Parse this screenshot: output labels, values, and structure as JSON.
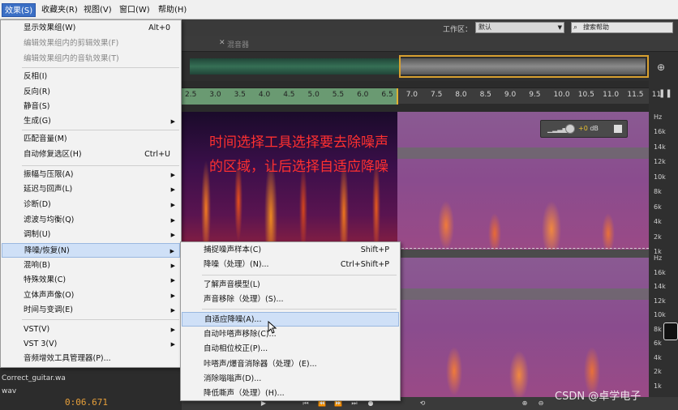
{
  "menubar": {
    "items": [
      "效果(S)",
      "收藏夹(R)",
      "视图(V)",
      "窗口(W)",
      "帮助(H)"
    ]
  },
  "header": {
    "workspace_label": "工作区：",
    "workspace_value": "默认",
    "search_placeholder": "搜索帮助",
    "mixer_tab": "混音器"
  },
  "effects_menu": {
    "items": [
      {
        "label": "显示效果组(W)",
        "shortcut": "Alt+0",
        "disabled": false,
        "submenu": false
      },
      {
        "label": "编辑效果组内的剪辑效果(F)",
        "shortcut": "",
        "disabled": true,
        "submenu": false
      },
      {
        "label": "编辑效果组内的音轨效果(T)",
        "shortcut": "",
        "disabled": true,
        "submenu": false
      },
      {
        "label": "反相(I)",
        "shortcut": "",
        "disabled": false,
        "submenu": false
      },
      {
        "label": "反向(R)",
        "shortcut": "",
        "disabled": false,
        "submenu": false
      },
      {
        "label": "静音(S)",
        "shortcut": "",
        "disabled": false,
        "submenu": false
      },
      {
        "label": "生成(G)",
        "shortcut": "",
        "disabled": false,
        "submenu": true
      },
      {
        "label": "匹配音量(M)",
        "shortcut": "",
        "disabled": false,
        "submenu": false
      },
      {
        "label": "自动修复选区(H)",
        "shortcut": "Ctrl+U",
        "disabled": false,
        "submenu": false
      },
      {
        "label": "振幅与压限(A)",
        "shortcut": "",
        "disabled": false,
        "submenu": true
      },
      {
        "label": "延迟与回声(L)",
        "shortcut": "",
        "disabled": false,
        "submenu": true
      },
      {
        "label": "诊断(D)",
        "shortcut": "",
        "disabled": false,
        "submenu": true
      },
      {
        "label": "滤波与均衡(Q)",
        "shortcut": "",
        "disabled": false,
        "submenu": true
      },
      {
        "label": "调制(U)",
        "shortcut": "",
        "disabled": false,
        "submenu": true
      },
      {
        "label": "降噪/恢复(N)",
        "shortcut": "",
        "disabled": false,
        "submenu": true,
        "highlight": true
      },
      {
        "label": "混响(B)",
        "shortcut": "",
        "disabled": false,
        "submenu": true
      },
      {
        "label": "特殊效果(C)",
        "shortcut": "",
        "disabled": false,
        "submenu": true
      },
      {
        "label": "立体声声像(O)",
        "shortcut": "",
        "disabled": false,
        "submenu": true
      },
      {
        "label": "时间与变调(E)",
        "shortcut": "",
        "disabled": false,
        "submenu": true
      },
      {
        "label": "VST(V)",
        "shortcut": "",
        "disabled": false,
        "submenu": true
      },
      {
        "label": "VST 3(V)",
        "shortcut": "",
        "disabled": false,
        "submenu": true
      },
      {
        "label": "音频增效工具管理器(P)...",
        "shortcut": "",
        "disabled": false,
        "submenu": false
      }
    ]
  },
  "submenu": {
    "items": [
      {
        "label": "捕捉噪声样本(C)",
        "shortcut": "Shift+P"
      },
      {
        "label": "降噪（处理）(N)...",
        "shortcut": "Ctrl+Shift+P"
      },
      {
        "label": "了解声音模型(L)",
        "shortcut": ""
      },
      {
        "label": "声音移除（处理）(S)...",
        "shortcut": ""
      },
      {
        "label": "自适应降噪(A)...",
        "shortcut": "",
        "highlight": true
      },
      {
        "label": "自动咔嗒声移除(C)...",
        "shortcut": ""
      },
      {
        "label": "自动相位校正(P)...",
        "shortcut": ""
      },
      {
        "label": "咔嗒声/爆音消除器（处理）(E)...",
        "shortcut": ""
      },
      {
        "label": "消除嗡嗡声(D)...",
        "shortcut": ""
      },
      {
        "label": "降低嘶声（处理）(H)...",
        "shortcut": ""
      }
    ]
  },
  "ruler": {
    "ticks": [
      "2.5",
      "3.0",
      "3.5",
      "4.0",
      "4.5",
      "5.0",
      "5.5",
      "6.0",
      "6.5",
      "7.0",
      "7.5",
      "8.0",
      "8.5",
      "9.0",
      "9.5",
      "10.0",
      "10.5",
      "11.0",
      "11.5",
      "11"
    ]
  },
  "hz_scale": {
    "unit": "Hz",
    "upper": [
      "16k",
      "14k",
      "12k",
      "10k",
      "8k",
      "6k",
      "4k",
      "2k",
      "1k"
    ],
    "lower": [
      "Hz",
      "16k",
      "14k",
      "12k",
      "10k",
      "8k",
      "6k",
      "4k",
      "2k",
      "1k"
    ]
  },
  "volume": {
    "value": "+0",
    "unit": "dB"
  },
  "annotation": {
    "line1": "时间选择工具选择要去除噪声",
    "line2": "的区域，让后选择自适应降噪"
  },
  "files": {
    "item1": "Correct_guitar.wa",
    "item2": "wav"
  },
  "timecode": "0:06.671",
  "watermark": "CSDN @卓学电子",
  "colors": {
    "annotation": "#ff3030",
    "menu_highlight": "#cfe0f7",
    "selection": "#6a9a72",
    "playhead": "#e0b030"
  }
}
